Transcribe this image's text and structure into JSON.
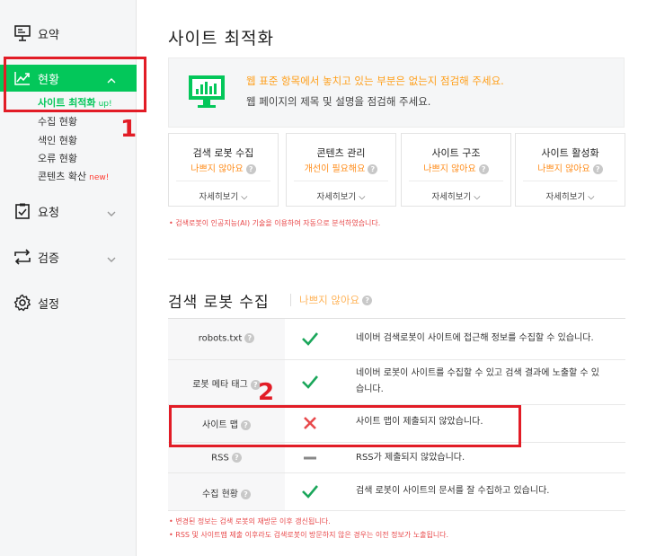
{
  "sidebar": {
    "summary": "요약",
    "status": "현황",
    "submenu": {
      "site_optimization": "사이트 최적화",
      "site_optimization_badge": "up!",
      "collection_status": "수집 현황",
      "index_status": "색인 현황",
      "error_status": "오류 현황",
      "content_spread": "콘텐츠 확산",
      "content_spread_badge": "new!"
    },
    "request": "요청",
    "verify": "검증",
    "settings": "설정"
  },
  "annotations": {
    "one": "1",
    "two": "2"
  },
  "page_title": "사이트 최적화",
  "banner": {
    "line1": "웹 표준 항목에서 놓치고 있는 부분은 없는지 점검해 주세요.",
    "line2": "웹 페이지의 제목 및 설명을 점검해 주세요."
  },
  "cards": [
    {
      "title": "검색 로봇 수집",
      "status": "나쁘지 않아요",
      "more": "자세히보기"
    },
    {
      "title": "콘텐츠 관리",
      "status": "개선이 필요해요",
      "more": "자세히보기"
    },
    {
      "title": "사이트 구조",
      "status": "나쁘지 않아요",
      "more": "자세히보기"
    },
    {
      "title": "사이트 활성화",
      "status": "나쁘지 않아요",
      "more": "자세히보기"
    }
  ],
  "ai_note": "• 검색로봇이 인공지능(AI) 기술을 이용하여 자동으로 분석하였습니다.",
  "robot_section": {
    "title": "검색 로봇 수집",
    "status": "나쁘지 않아요",
    "rows": [
      {
        "name": "robots.txt",
        "result": "pass",
        "desc": "네이버 검색로봇이 사이트에 접근해 정보를 수집할 수 있습니다."
      },
      {
        "name": "로봇 메타 태그",
        "result": "pass",
        "desc1": "네이버 로봇이 사이트를 수집할 수 있고 검색 결과에 노출할 수 있",
        "desc2": "습니다."
      },
      {
        "name": "사이트 맵",
        "result": "fail",
        "desc": "사이트 맵이 제출되지 않았습니다."
      },
      {
        "name": "RSS",
        "result": "none",
        "desc": "RSS가 제출되지 않았습니다."
      },
      {
        "name": "수집 현황",
        "result": "pass",
        "desc": "검색 로봇이 사이트의 문서를 잘 수집하고 있습니다."
      }
    ]
  },
  "footnotes": {
    "note1": "• 변경된 정보는 검색 로봇의 재방문 이후 갱신됩니다.",
    "note2": "• RSS 및 사이트맵 제출 이후라도 검색로봇이 방문하지 않은 경우는 이전 정보가 노출됩니다."
  },
  "colors": {
    "accent": "#03c75a",
    "warning": "#ff8c1a",
    "annotation": "#e21c26",
    "fail": "#e8484a"
  }
}
